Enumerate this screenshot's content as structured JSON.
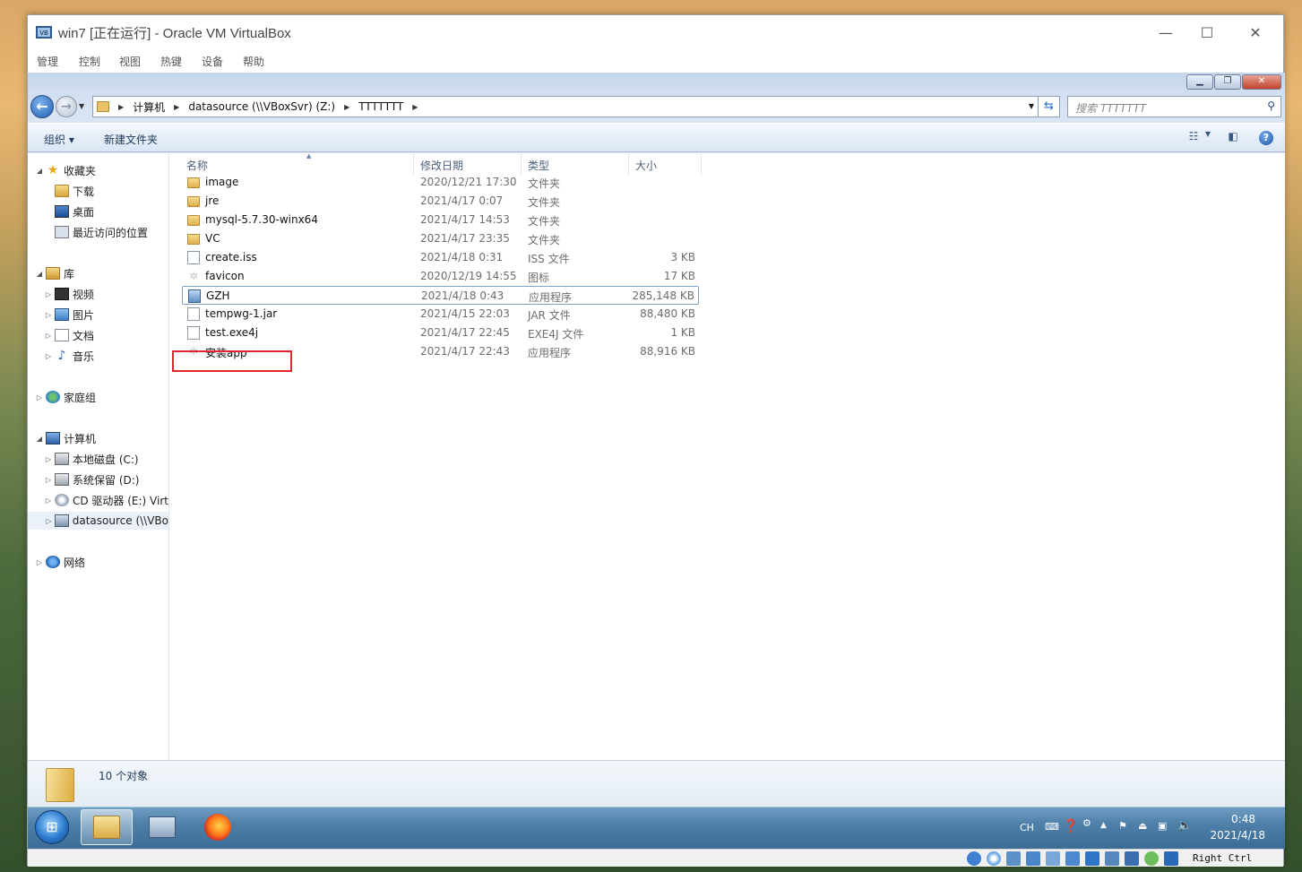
{
  "host_window": {
    "title": "win7 [正在运行] - Oracle VM VirtualBox",
    "menu": [
      "管理",
      "控制",
      "视图",
      "热键",
      "设备",
      "帮助"
    ],
    "controls": {
      "minimize": "—",
      "maximize": "☐",
      "close": "✕"
    }
  },
  "explorer": {
    "caption_buttons": {
      "minimize": "▁",
      "restore": "❐",
      "close": "✕"
    },
    "address_segments": [
      "计算机",
      "datasource (\\\\VBoxSvr) (Z:)",
      "TTTTTTT"
    ],
    "search_placeholder": "搜索 TTTTTTT",
    "toolbar": {
      "organize": "组织 ▾",
      "new_folder": "新建文件夹",
      "help": "?"
    },
    "nav_pane": {
      "favorites": "收藏夹",
      "downloads": "下载",
      "desktop": "桌面",
      "recent": "最近访问的位置",
      "libraries": "库",
      "videos": "视频",
      "pictures": "图片",
      "documents": "文档",
      "music": "音乐",
      "homegroup": "家庭组",
      "computer": "计算机",
      "drive_c": "本地磁盘 (C:)",
      "drive_d": "系统保留 (D:)",
      "drive_e": "CD 驱动器 (E:) Virtu",
      "drive_z": "datasource (\\\\VBo",
      "network": "网络"
    },
    "columns": {
      "name": "名称",
      "date": "修改日期",
      "type": "类型",
      "size": "大小"
    },
    "files": [
      {
        "name": "image",
        "date": "2020/12/21 17:30",
        "type": "文件夹",
        "size": "",
        "icon": "folder-icon"
      },
      {
        "name": "jre",
        "date": "2021/4/17 0:07",
        "type": "文件夹",
        "size": "",
        "icon": "folder-icon"
      },
      {
        "name": "mysql-5.7.30-winx64",
        "date": "2021/4/17 14:53",
        "type": "文件夹",
        "size": "",
        "icon": "folder-icon"
      },
      {
        "name": "VC",
        "date": "2021/4/17 23:35",
        "type": "文件夹",
        "size": "",
        "icon": "folder-icon"
      },
      {
        "name": "create.iss",
        "date": "2021/4/18 0:31",
        "type": "ISS 文件",
        "size": "3 KB",
        "icon": "file-icon"
      },
      {
        "name": "favicon",
        "date": "2020/12/19 14:55",
        "type": "图标",
        "size": "17 KB",
        "icon": "ico-file-icon"
      },
      {
        "name": "GZH",
        "date": "2021/4/18 0:43",
        "type": "应用程序",
        "size": "285,148 KB",
        "icon": "app-icon"
      },
      {
        "name": "tempwg-1.jar",
        "date": "2021/4/15 22:03",
        "type": "JAR 文件",
        "size": "88,480 KB",
        "icon": "file-icon"
      },
      {
        "name": "test.exe4j",
        "date": "2021/4/17 22:45",
        "type": "EXE4J 文件",
        "size": "1 KB",
        "icon": "file-icon"
      },
      {
        "name": "安装app",
        "date": "2021/4/17 22:43",
        "type": "应用程序",
        "size": "88,916 KB",
        "icon": "ico-file-icon"
      }
    ],
    "selected_file": "GZH",
    "details": {
      "count": "10 个对象"
    }
  },
  "taskbar": {
    "start_glyph": "⊞",
    "tray": {
      "lang": "CH",
      "time": "0:48",
      "date": "2021/4/18"
    }
  },
  "vbox_status": {
    "host_key": "Right Ctrl"
  },
  "colors": {
    "highlight_box": "#e0242b",
    "selected_row_border": "#7da2ce"
  }
}
